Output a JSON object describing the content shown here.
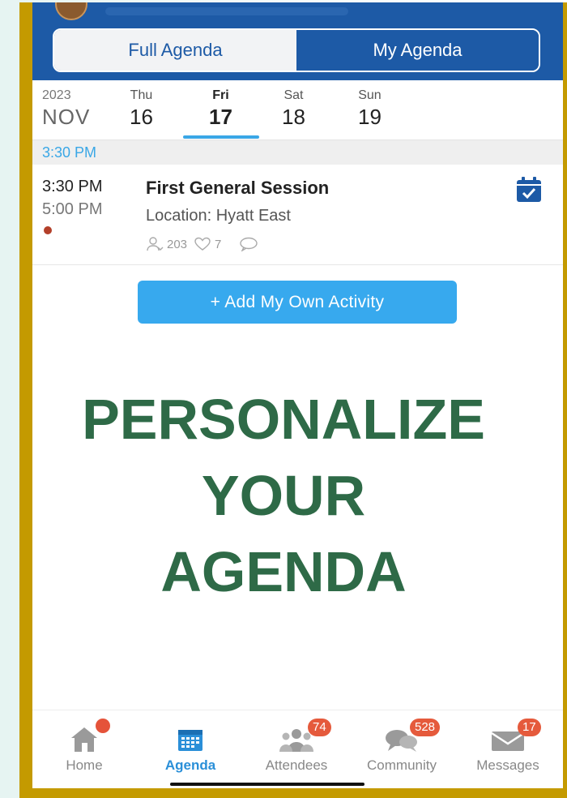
{
  "tabs_segment": {
    "full": "Full Agenda",
    "my": "My Agenda",
    "selected": "my"
  },
  "dates": {
    "year": "2023",
    "month": "NOV",
    "days": [
      {
        "dow": "Thu",
        "num": "16"
      },
      {
        "dow": "Fri",
        "num": "17"
      },
      {
        "dow": "Sat",
        "num": "18"
      },
      {
        "dow": "Sun",
        "num": "19"
      }
    ],
    "selected": "Fri"
  },
  "time_header": "3:30 PM",
  "session": {
    "start": "3:30 PM",
    "end": "5:00 PM",
    "title": "First General Session",
    "location": "Location: Hyatt East",
    "attendees": "203",
    "likes": "7",
    "dot_color": "#b3402a"
  },
  "add_button": "+ Add My Own Activity",
  "headline": [
    "PERSONALIZE",
    "YOUR",
    "AGENDA"
  ],
  "tabbar": {
    "home": {
      "label": "Home"
    },
    "agenda": {
      "label": "Agenda"
    },
    "attendees": {
      "label": "Attendees",
      "badge": "74"
    },
    "community": {
      "label": "Community",
      "badge": "528"
    },
    "messages": {
      "label": "Messages",
      "badge": "17"
    }
  },
  "colors": {
    "brand": "#1d5aa6",
    "accent": "#37a9ee",
    "headline": "#2e6a47",
    "frame": "#c49a00",
    "badge": "#e55a3c"
  }
}
